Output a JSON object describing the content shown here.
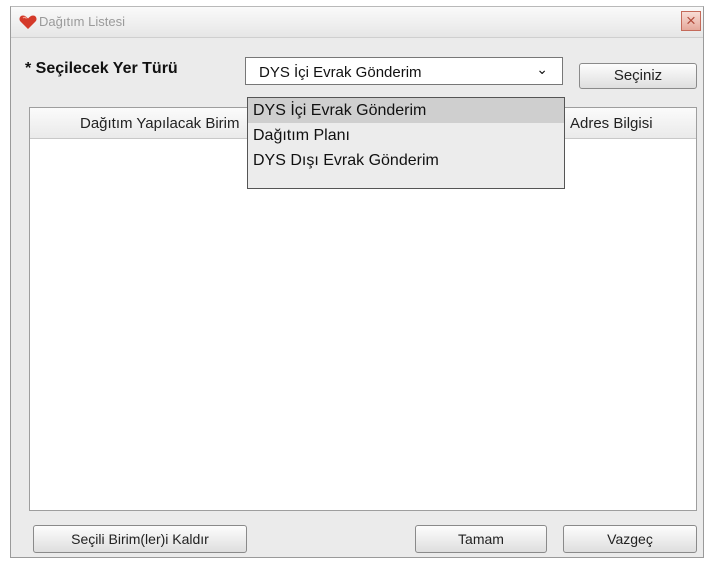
{
  "window": {
    "title": "Dağıtım Listesi",
    "close_glyph": "×",
    "icon": "red-heart-icon"
  },
  "form": {
    "field_label": "* Seçilecek Yer Türü",
    "select_value": "DYS İçi Evrak Gönderim",
    "select_button": "Seçiniz",
    "dropdown_options": [
      "DYS İçi Evrak Gönderim",
      "Dağıtım Planı",
      "DYS Dışı Evrak Gönderim"
    ],
    "selected_index": 0
  },
  "table": {
    "columns": [
      "Dağıtım Yapılacak Birim",
      "Adres Bilgisi"
    ],
    "rows": []
  },
  "footer": {
    "remove_button": "Seçili Birim(ler)i Kaldır",
    "ok_button": "Tamam",
    "cancel_button": "Vazgeç"
  },
  "colors": {
    "dialog_bg": "#ebebeb",
    "icon_red": "#d43a2a",
    "close_red": "#b04a3a"
  }
}
